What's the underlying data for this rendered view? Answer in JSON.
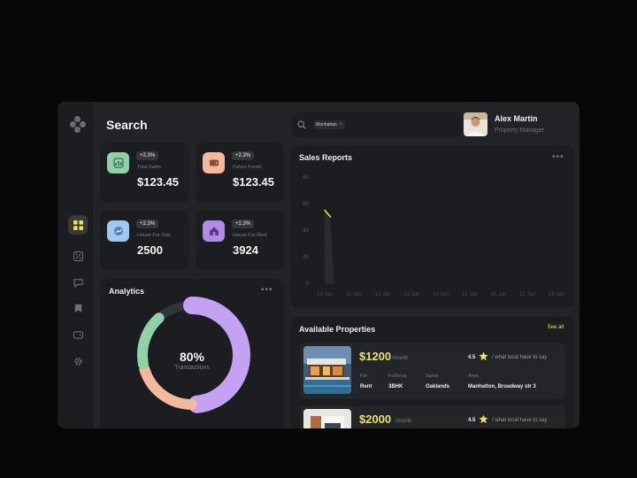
{
  "colors": {
    "accent": "#e8e36b",
    "panel": "#1c1d20",
    "background": "#222326",
    "donut_purple": "#c4a1f2",
    "donut_peach": "#f2b99c",
    "donut_green": "#8fd1a8",
    "line": "#e8e36b"
  },
  "header": {
    "title": "Search"
  },
  "search": {
    "chip_label": "Manhattan",
    "chip_close": "×"
  },
  "user": {
    "name": "Alex Martin",
    "role": "Property Manager"
  },
  "sidebar": {
    "items": [
      {
        "icon": "dashboard-grid-icon",
        "active": true
      },
      {
        "icon": "percent-icon",
        "active": false
      },
      {
        "icon": "chat-icon",
        "active": false
      },
      {
        "icon": "bookmark-icon",
        "active": false
      },
      {
        "icon": "wallet-icon",
        "active": false
      },
      {
        "icon": "gear-icon",
        "active": false
      }
    ]
  },
  "stats": [
    {
      "label": "Total Sales",
      "value": "$123.45",
      "badge": "+2.3%",
      "icon": "chart-icon",
      "color": "#8fd1a8"
    },
    {
      "label": "Future Funds",
      "value": "$123.45",
      "badge": "+2.3%",
      "icon": "wallet-icon",
      "color": "#f2b99c"
    },
    {
      "label": "House For Sale",
      "value": "2500",
      "badge": "+2.3%",
      "icon": "trend-icon",
      "color": "#9ec8f2"
    },
    {
      "label": "House For Rent",
      "value": "3924",
      "badge": "+2.3%",
      "icon": "house-icon",
      "color": "#b08ce8"
    }
  ],
  "analytics": {
    "title": "Analytics",
    "more": "•••",
    "value": "80%",
    "label": "Transactions",
    "segments": [
      {
        "name": "purple",
        "percent": 50,
        "color": "#c4a1f2"
      },
      {
        "name": "peach",
        "percent": 22,
        "color": "#f2b99c"
      },
      {
        "name": "green",
        "percent": 18,
        "color": "#8fd1a8"
      },
      {
        "name": "track",
        "percent": 10,
        "color": "#34353a"
      }
    ]
  },
  "sales": {
    "title": "Sales Reports",
    "more": "•••"
  },
  "chart_data": {
    "type": "line",
    "title": "Sales Reports",
    "xlabel": "",
    "ylabel": "",
    "categories": [
      "10 Jan",
      "11 Jan",
      "12 Jan",
      "13 Jan",
      "14 Jan",
      "15 Jan",
      "16 Jan",
      "17 Jan",
      "18 Jan"
    ],
    "y_ticks": [
      0,
      20,
      40,
      60,
      80
    ],
    "ylim": [
      0,
      80
    ],
    "series": [
      {
        "x": [
          10.0,
          10.2
        ],
        "values": [
          55,
          50
        ]
      }
    ],
    "grid": false
  },
  "properties": {
    "title": "Available Properties",
    "see_all": "See all",
    "items": [
      {
        "price": "$1200",
        "period": "/month",
        "rating": "4.5",
        "review": "/ what local have to say",
        "fields": [
          {
            "label": "For",
            "value": "Rent"
          },
          {
            "label": "Fullness",
            "value": "3BHK"
          },
          {
            "label": "Name",
            "value": "Oaklands"
          },
          {
            "label": "Area",
            "value": "Manhatton, Broadway str 3"
          }
        ]
      },
      {
        "price": "$2000",
        "period": "/month",
        "rating": "4.5",
        "review": "/ what local have to say"
      }
    ]
  }
}
